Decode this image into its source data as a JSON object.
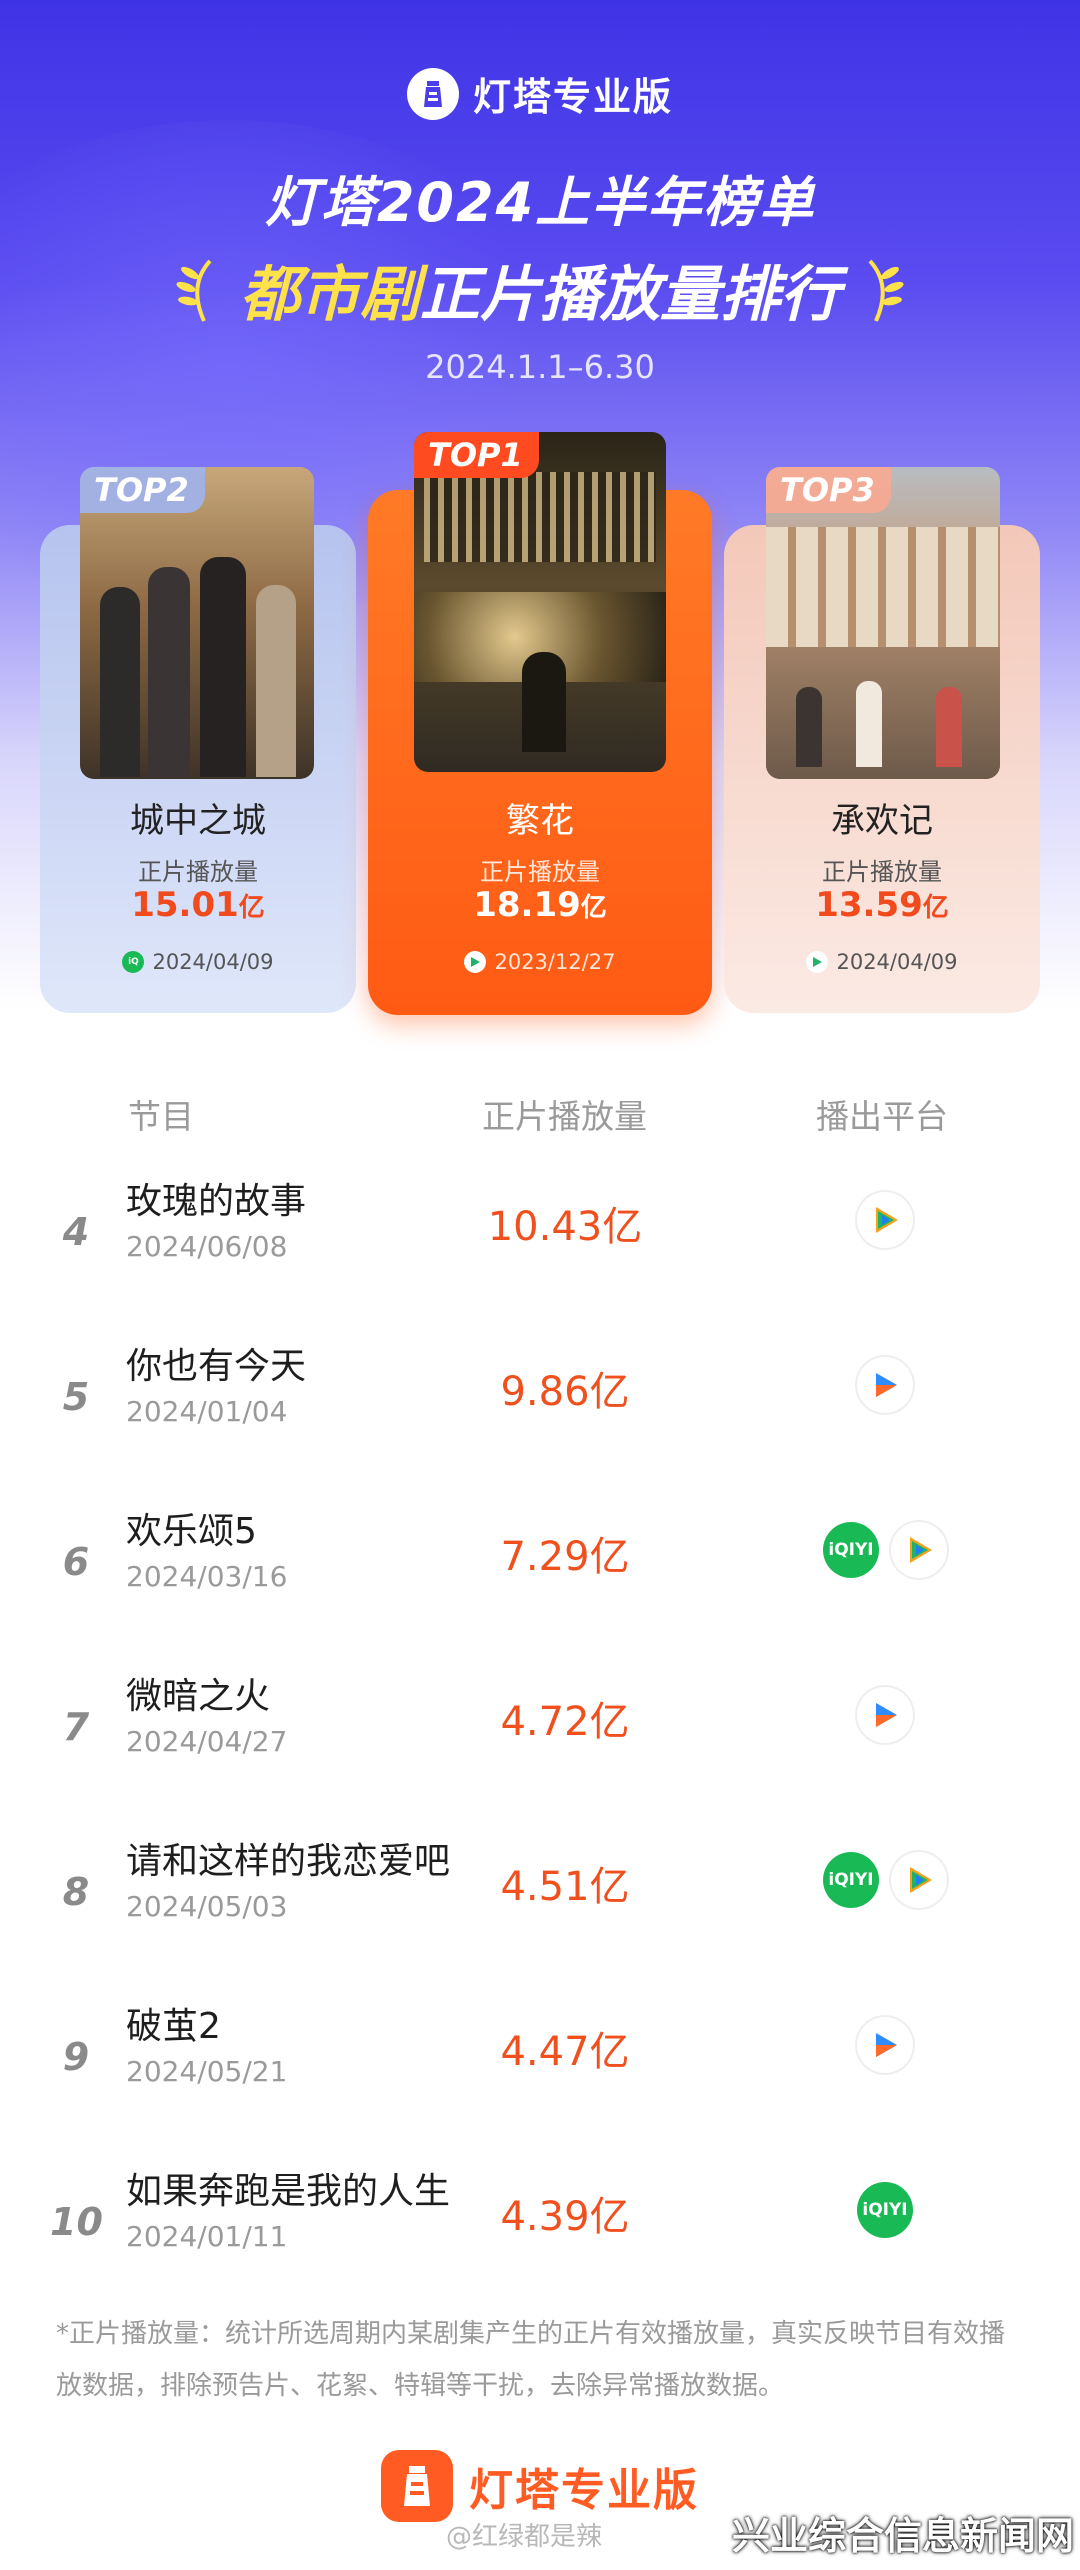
{
  "header": {
    "brand": "灯塔专业版",
    "title": "灯塔2024上半年榜单",
    "subtitle_highlight": "都市剧",
    "subtitle_rest": "正片播放量排行",
    "date_range": "2024.1.1–6.30"
  },
  "top3": [
    {
      "badge": "TOP2",
      "name": "城中之城",
      "label": "正片播放量",
      "value": "15.01",
      "unit": "亿",
      "date": "2024/04/09",
      "platform": "iqiyi"
    },
    {
      "badge": "TOP1",
      "name": "繁花",
      "label": "正片播放量",
      "value": "18.19",
      "unit": "亿",
      "date": "2023/12/27",
      "platform": "tencent-video"
    },
    {
      "badge": "TOP3",
      "name": "承欢记",
      "label": "正片播放量",
      "value": "13.59",
      "unit": "亿",
      "date": "2024/04/09",
      "platform": "tencent-video"
    }
  ],
  "table": {
    "headers": [
      "节目",
      "正片播放量",
      "播出平台"
    ],
    "rows": [
      {
        "rank": "4",
        "name": "玫瑰的故事",
        "date": "2024/06/08",
        "value": "10.43亿",
        "platforms": [
          "tencent-video"
        ]
      },
      {
        "rank": "5",
        "name": "你也有今天",
        "date": "2024/01/04",
        "value": "9.86亿",
        "platforms": [
          "youku"
        ]
      },
      {
        "rank": "6",
        "name": "欢乐颂5",
        "date": "2024/03/16",
        "value": "7.29亿",
        "platforms": [
          "iqiyi",
          "tencent-video"
        ]
      },
      {
        "rank": "7",
        "name": "微暗之火",
        "date": "2024/04/27",
        "value": "4.72亿",
        "platforms": [
          "youku"
        ]
      },
      {
        "rank": "8",
        "name": "请和这样的我恋爱吧",
        "date": "2024/05/03",
        "value": "4.51亿",
        "platforms": [
          "iqiyi",
          "tencent-video"
        ]
      },
      {
        "rank": "9",
        "name": "破茧2",
        "date": "2024/05/21",
        "value": "4.47亿",
        "platforms": [
          "youku"
        ]
      },
      {
        "rank": "10",
        "name": "如果奔跑是我的人生",
        "date": "2024/01/11",
        "value": "4.39亿",
        "platforms": [
          "iqiyi"
        ]
      }
    ]
  },
  "footnote": "*正片播放量：统计所选周期内某剧集产生的正片有效播放量，真实反映节目有效播放数据，排除预告片、花絮、特辑等干扰，去除异常播放数据。",
  "footer": {
    "brand": "灯塔专业版",
    "weibo": "@红绿都是辣"
  },
  "watermark": "兴业综合信息新闻网",
  "colors": {
    "accent": "#f0501e",
    "header_blue": "#3f33e6",
    "highlight_yellow": "#ffe14a",
    "iqiyi_green": "#19b955"
  }
}
